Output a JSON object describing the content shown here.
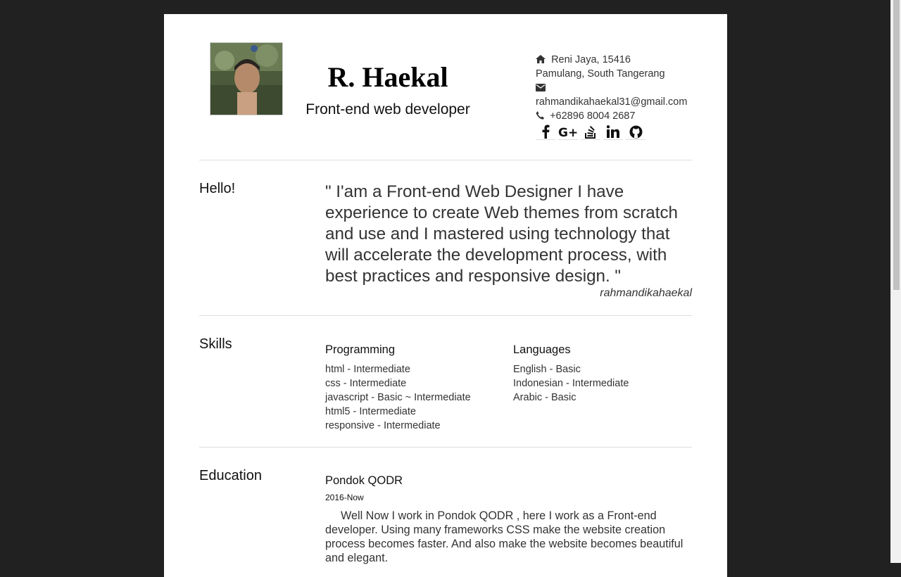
{
  "profile": {
    "name": "R. Haekal",
    "role": "Front-end web developer",
    "address_line1": "Reni Jaya, 15416",
    "address_line2": "Pamulang, South Tangerang",
    "email": "rahmandikahaekal31@gmail.com",
    "phone": "+62896 8004 2687",
    "socials": [
      "facebook-icon",
      "google-plus-icon",
      "stackoverflow-icon",
      "linkedin-icon",
      "github-icon"
    ]
  },
  "hello": {
    "title": "Hello!",
    "quote": "\" I'am a Front-end Web Designer I have experience to create Web themes from scratch and use and I mastered using technology that will accelerate the development process, with best practices and responsive design. \"",
    "author": "rahmandikahaekal"
  },
  "skills": {
    "title": "Skills",
    "programming": {
      "heading": "Programming",
      "items": [
        "html - Intermediate",
        "css - Intermediate",
        "javascript - Basic ~ Intermediate",
        "html5 - Intermediate",
        "responsive - Intermediate"
      ]
    },
    "languages": {
      "heading": "Languages",
      "items": [
        "English - Basic",
        "Indonesian - Intermediate",
        "Arabic - Basic"
      ]
    }
  },
  "education": {
    "title": "Education",
    "school": "Pondok QODR",
    "period": "2016-Now",
    "description": "Well Now I work in Pondok QODR , here I work as a Front-end developer. Using many frameworks CSS make the website creation process becomes faster. And also make the website becomes beautiful and elegant."
  },
  "colors": {
    "background": "#212121",
    "page": "#ffffff",
    "text": "#333333"
  }
}
